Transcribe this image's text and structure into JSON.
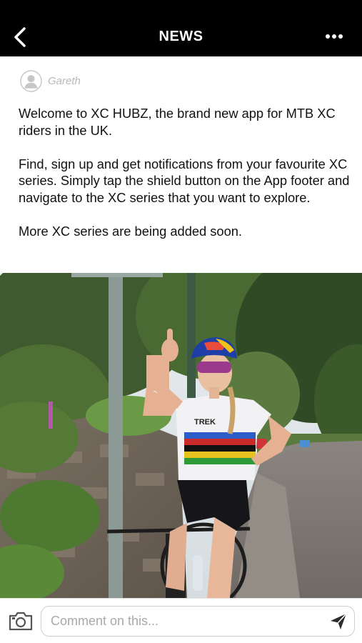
{
  "header": {
    "title": "NEWS",
    "back_icon": "chevron-left-icon",
    "menu_icon": "more-horizontal-icon"
  },
  "post": {
    "author": "Gareth",
    "avatar_icon": "user-avatar-icon",
    "paragraphs": [
      "Welcome to XC HUBZ, the brand new app for MTB XC riders in the UK.",
      "Find, sign up and get notifications from your favourite XC series. Simply tap the shield button on the App footer and navigate to the XC series that you want to explore.",
      "More XC series are being added soon."
    ],
    "jersey_text": "TREK"
  },
  "footer": {
    "camera_icon": "camera-icon",
    "comment_placeholder": "Comment on this...",
    "send_icon": "send-icon"
  },
  "colors": {
    "header_bg": "#000000",
    "author_gray": "#b8b8b8",
    "border": "#cfcfcf"
  }
}
